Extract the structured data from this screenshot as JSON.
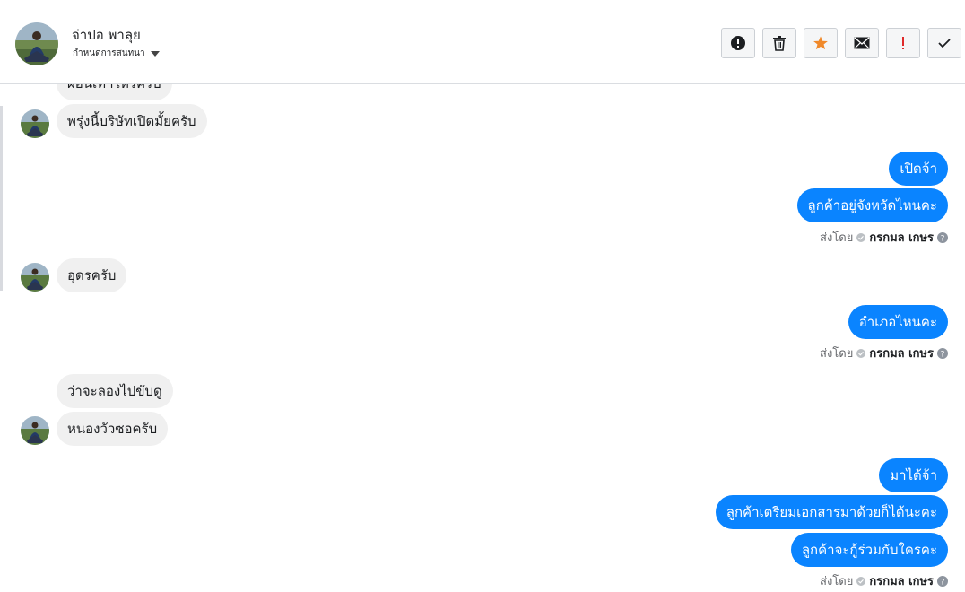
{
  "header": {
    "contact_name": "จ่าปอ พาลุย",
    "conversation_label": "กำหนดการสนทนา",
    "actions": [
      {
        "icon": "alert-circle-icon",
        "name": "report-button"
      },
      {
        "icon": "trash-icon",
        "name": "delete-button"
      },
      {
        "icon": "star-icon",
        "name": "star-button",
        "color": "#f0892a"
      },
      {
        "icon": "envelope-icon",
        "name": "mark-unread-button"
      },
      {
        "icon": "exclamation-icon",
        "name": "important-button",
        "color": "#e02a2a"
      },
      {
        "icon": "check-icon",
        "name": "done-button"
      }
    ]
  },
  "colors": {
    "outgoing": "#0a84ff",
    "incoming": "#f0f0f0",
    "important": "#e02a2a",
    "star": "#f0892a"
  },
  "messages": {
    "m0": "ผ่อนเท่าไหร่ครับ",
    "m1": "พรุ่งนี้บริษัทเปิดมั้ยครับ",
    "m2": "เปิดจ้า",
    "m3": "ลูกค้าอยู่จังหวัดไหนคะ",
    "m4": "อุดรครับ",
    "m5": "อำเภอไหนคะ",
    "m6": "ว่าจะลองไปขับดู",
    "m7": "หนองวัวซอครับ",
    "m8": "มาได้จ้า",
    "m9": "ลูกค้าเตรียมเอกสารมาด้วยก็ได้นะคะ",
    "m10": "ลูกค้าจะกู้ร่วมกับใครคะ"
  },
  "meta": {
    "sent_by_label": "ส่งโดย",
    "agent_name": "กรกมล เกษร"
  }
}
